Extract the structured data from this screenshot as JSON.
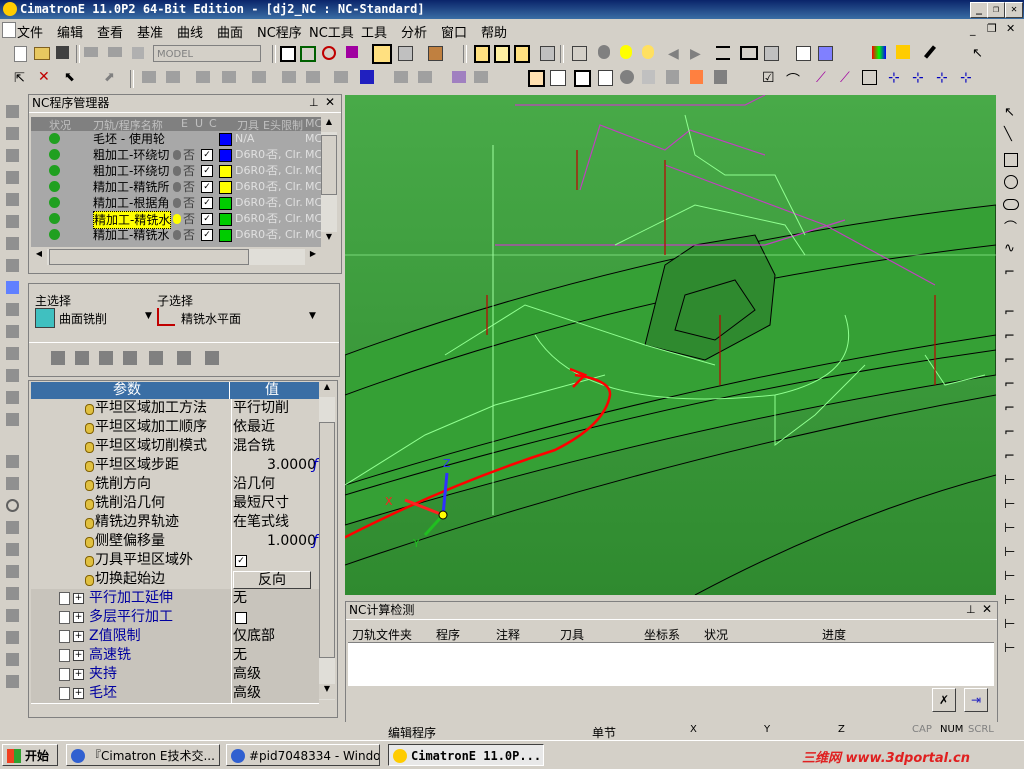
{
  "window": {
    "title": "CimatronE 11.0P2 64-Bit Edition - [dj2_NC : NC-Standard]"
  },
  "menu": [
    "文件",
    "编辑",
    "查看",
    "基准",
    "曲线",
    "曲面",
    "NC程序",
    "NC工具",
    "工具",
    "分析",
    "窗口",
    "帮助"
  ],
  "toolbar": {
    "model_combo": "MODEL"
  },
  "nc_manager": {
    "title": "NC程序管理器",
    "columns": [
      "状况",
      "刀轨/程序名称",
      "E",
      "U",
      "C",
      "刀具",
      "E头限制",
      "MC"
    ],
    "rows": [
      {
        "name": "毛坯 - 使用轮",
        "tool": "N/A",
        "limit": "",
        "mc": "MC",
        "color": "#0000ff",
        "checked": false,
        "highlight": false
      },
      {
        "name": "粗加工-环绕切",
        "tool": "D6R0-",
        "limit": "否, Clr.",
        "mc": "MC",
        "color": "#0000ff",
        "checked": true,
        "highlight": false
      },
      {
        "name": "粗加工-环绕切",
        "tool": "D6R0-",
        "limit": "否, Clr.",
        "mc": "MC",
        "color": "#ffff00",
        "checked": true,
        "highlight": false
      },
      {
        "name": "精加工-精铣所",
        "tool": "D6R0-",
        "limit": "否, Clr.",
        "mc": "MC",
        "color": "#ffff00",
        "checked": true,
        "highlight": false
      },
      {
        "name": "精加工-根据角",
        "tool": "D6R0-",
        "limit": "否, Clr.",
        "mc": "MC",
        "color": "#00cc00",
        "checked": true,
        "highlight": false
      },
      {
        "name": "精加工-精铣水",
        "tool": "D6R0-",
        "limit": "否, Clr.",
        "mc": "MC",
        "color": "#00cc00",
        "checked": true,
        "highlight": true
      },
      {
        "name": "精加工-精铣水",
        "tool": "D6R0-",
        "limit": "否, Clr.",
        "mc": "MC",
        "color": "#00cc00",
        "checked": true,
        "highlight": false
      }
    ],
    "no_label": "否"
  },
  "selection": {
    "main_label": "主选择",
    "sub_label": "子选择",
    "main_value": "曲面铣削",
    "sub_value": "精铣水平面"
  },
  "params": {
    "header_param": "参数",
    "header_value": "值",
    "rows": [
      {
        "label": "平坦区域加工方法",
        "value": "平行切削",
        "type": "text",
        "group": false
      },
      {
        "label": "平坦区域加工顺序",
        "value": "依最近",
        "type": "text",
        "group": false
      },
      {
        "label": "平坦区域切削模式",
        "value": "混合铣",
        "type": "text",
        "group": false
      },
      {
        "label": "平坦区域步距",
        "value": "3.0000",
        "type": "num",
        "group": false
      },
      {
        "label": "铣削方向",
        "value": "沿几何",
        "type": "text",
        "group": false
      },
      {
        "label": "铣削沿几何",
        "value": "最短尺寸",
        "type": "text",
        "group": false
      },
      {
        "label": "精铣边界轨迹",
        "value": "在笔式线",
        "type": "text",
        "group": false
      },
      {
        "label": "侧壁偏移量",
        "value": "1.0000",
        "type": "num",
        "group": false
      },
      {
        "label": "刀具平坦区域外",
        "value": "✓",
        "type": "check",
        "group": false
      },
      {
        "label": "切换起始边",
        "value": "反向",
        "type": "button",
        "group": false
      },
      {
        "label": "平行加工延伸",
        "value": "无",
        "type": "text",
        "group": true
      },
      {
        "label": "多层平行加工",
        "value": "",
        "type": "check",
        "group": true
      },
      {
        "label": "Z值限制",
        "value": "仅底部",
        "type": "text",
        "group": true
      },
      {
        "label": "高速铣",
        "value": "无",
        "type": "text",
        "group": true
      },
      {
        "label": "夹持",
        "value": "高级",
        "type": "text",
        "group": true
      },
      {
        "label": "毛坯",
        "value": "高级",
        "type": "text",
        "group": true
      }
    ]
  },
  "nc_check": {
    "title": "NC计算检测",
    "columns": [
      "刀轨文件夹",
      "程序",
      "注释",
      "刀具",
      "坐标系",
      "状况",
      "进度"
    ]
  },
  "axes": {
    "x": "X",
    "y": "Y",
    "z": "Z"
  },
  "status": {
    "mode": "编辑程序",
    "step": "单节",
    "x": "X",
    "y": "Y",
    "z": "Z",
    "caps": "CAP",
    "num": "NUM",
    "scrl": "SCRL"
  },
  "taskbar": {
    "start": "开始",
    "tasks": [
      "『Cimatron E技术交...",
      "#pid7048334 - Windo...",
      "CimatronE 11.0P..."
    ],
    "watermark": "三维网 www.3dportal.cn"
  }
}
